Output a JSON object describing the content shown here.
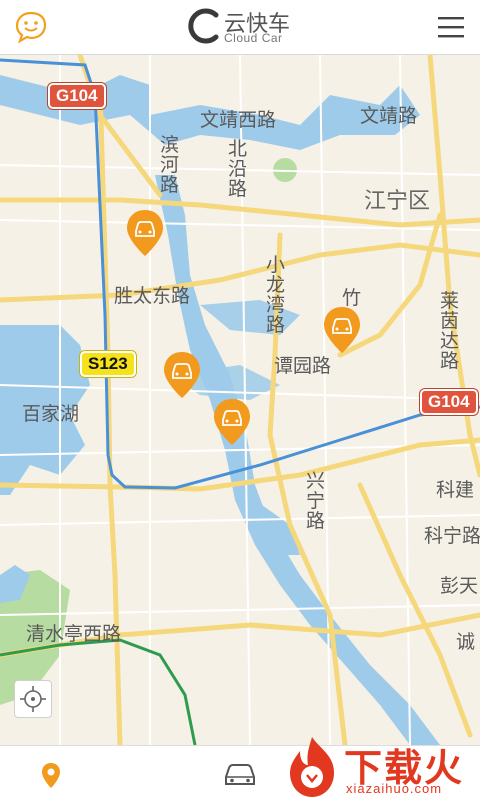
{
  "header": {
    "left_icon": "chat-smile-icon",
    "logo_cn": "云快车",
    "logo_en": "Cloud Car",
    "right_icon": "menu-icon"
  },
  "map": {
    "labels": {
      "wenjing_west": "文靖西路",
      "wenjing": "文靖路",
      "binhe": "滨河路",
      "beiyan": "北沿路",
      "jiangning": "江宁区",
      "shengtai_east": "胜太东路",
      "xiaolong": "小龙湾路",
      "zhu": "竹",
      "laiyin": "莱茵达路",
      "tanyuan": "谭园路",
      "baijia_lake": "百家湖",
      "xingning": "兴宁路",
      "kejian": "科建",
      "kening": "科宁路",
      "pengtian": "彭天",
      "cheng": "诚",
      "qingshuiting": "清水亭西路"
    },
    "shields": {
      "g104_a": "G104",
      "s123": "S123",
      "g104_b": "G104"
    },
    "colors": {
      "water": "#9ecbe9",
      "road_major": "#f5d77c",
      "highway_line": "#4a90d9",
      "metro_line": "#2e9c4f",
      "park": "#b6dca2",
      "car_pin": "#f29a1e"
    },
    "car_icon": "car-pin-icon"
  },
  "controls": {
    "locate_icon": "locate-crosshair-icon"
  },
  "bottom_tabs": {
    "location_icon": "location-pin-icon",
    "car_icon": "car-outline-icon"
  },
  "watermark": {
    "text": "下载火",
    "url": "xiazaihuo.com"
  }
}
